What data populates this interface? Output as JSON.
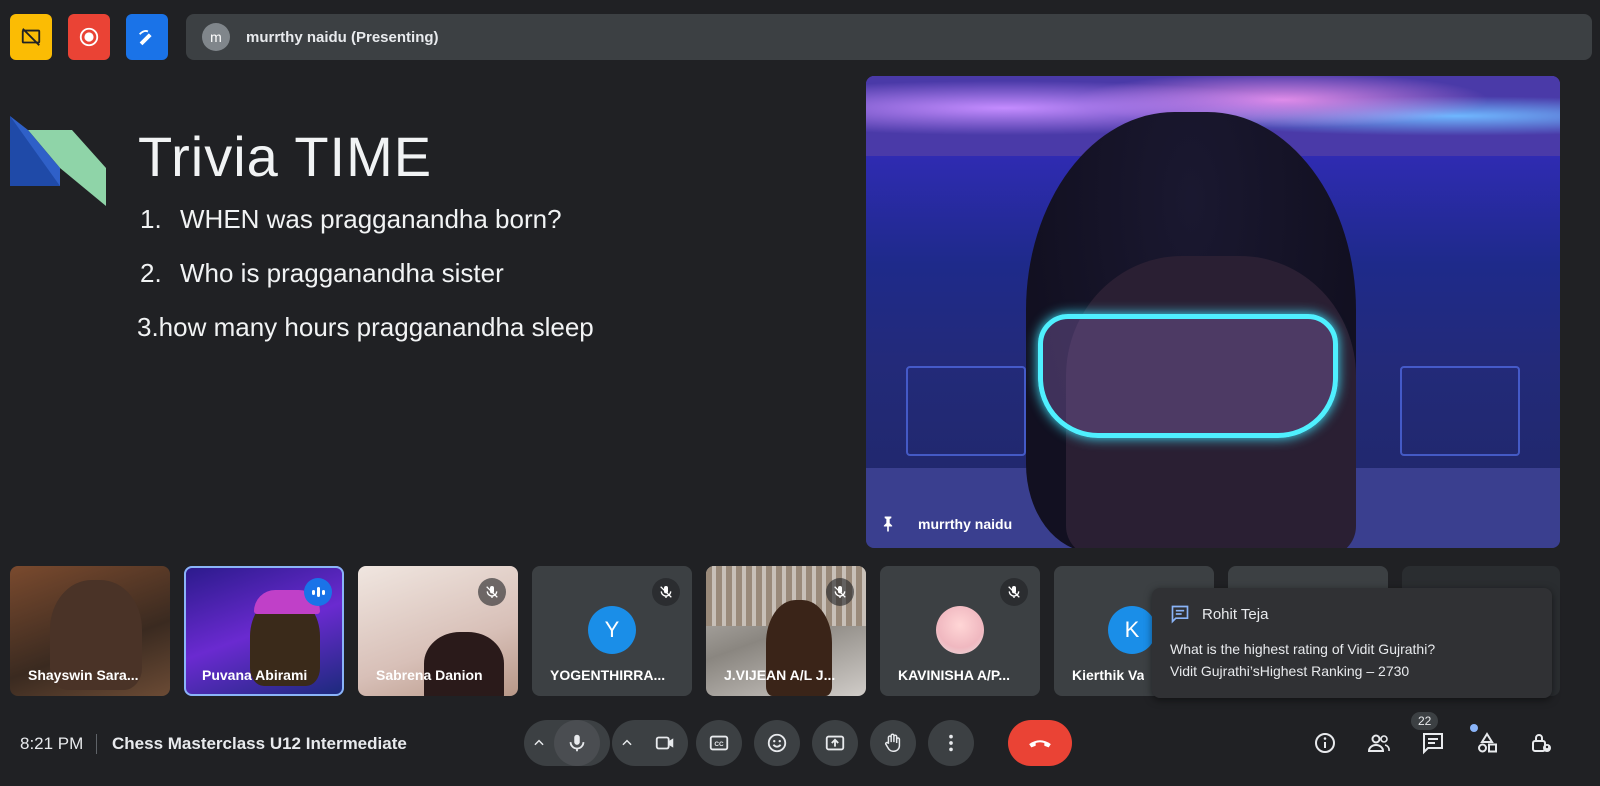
{
  "top": {
    "presenter_initial": "m",
    "presenting_label": "murrthy naidu (Presenting)"
  },
  "slide": {
    "title": "Trivia TIME",
    "items": [
      {
        "num": "1.",
        "text": "WHEN was pragganandha born?"
      },
      {
        "num": "2.",
        "text": "Who is pragganandha sister"
      },
      {
        "num": "",
        "text": "3.how many hours pragganandha sleep"
      }
    ]
  },
  "presenter": {
    "name": "murrthy naidu"
  },
  "participants": [
    {
      "name": "Shayswin Sara...",
      "type": "video",
      "muted": false
    },
    {
      "name": "Puvana Abirami",
      "type": "video",
      "speaking": true
    },
    {
      "name": "Sabrena Danion",
      "type": "video",
      "muted": true
    },
    {
      "name": "YOGENTHIRRA...",
      "type": "avatar",
      "initial": "Y",
      "color": "#1a8ee8",
      "muted": true
    },
    {
      "name": "J.VIJEAN A/L J...",
      "type": "video",
      "muted": true
    },
    {
      "name": "KAVINISHA A/P...",
      "type": "photo-avatar",
      "muted": true
    },
    {
      "name": "Kierthik Va",
      "type": "avatar",
      "initial": "K",
      "color": "#1a8ee8",
      "muted": true
    }
  ],
  "chat_toast": {
    "sender": "Rohit Teja",
    "line1": "What is the highest rating of Vidit Gujrathi?",
    "line2": "Vidit Gujrathi’sHighest Ranking – 2730"
  },
  "bottom": {
    "time": "8:21 PM",
    "meeting": "Chess Masterclass U12 Intermediate",
    "people_count": "22"
  },
  "colors": {
    "background": "#202124",
    "control": "#3c4043",
    "hangup": "#ea4335",
    "accent": "#8ab4f8"
  }
}
